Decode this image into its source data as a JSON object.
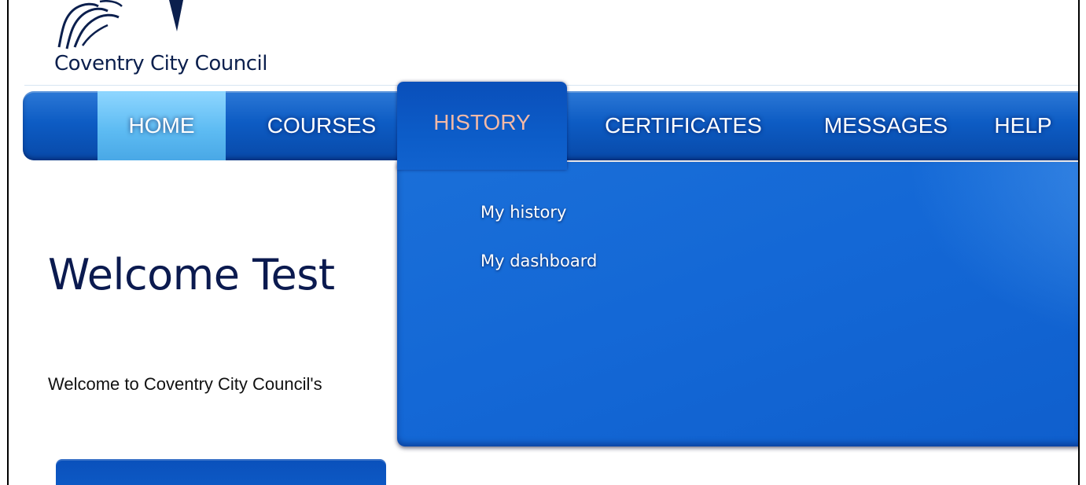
{
  "logo": {
    "icon": "coventry-elephant-swirl-logo",
    "text": "Coventry City Council"
  },
  "nav": {
    "items": [
      {
        "label": "HOME"
      },
      {
        "label": "COURSES"
      },
      {
        "label": "HISTORY"
      },
      {
        "label": "CERTIFICATES"
      },
      {
        "label": "MESSAGES"
      },
      {
        "label": "HELP"
      }
    ],
    "active": "HOME",
    "open_menu": "HISTORY"
  },
  "history_menu": {
    "items": [
      {
        "label": "My history"
      },
      {
        "label": "My dashboard"
      }
    ]
  },
  "main": {
    "title": "Welcome Test",
    "intro": "Welcome to Coventry City Council's"
  },
  "colors": {
    "nav_blue": "#0d5cc4",
    "home_active": "#5ebcf3",
    "history_label": "#f3b9a6",
    "title": "#0b1a4f"
  }
}
